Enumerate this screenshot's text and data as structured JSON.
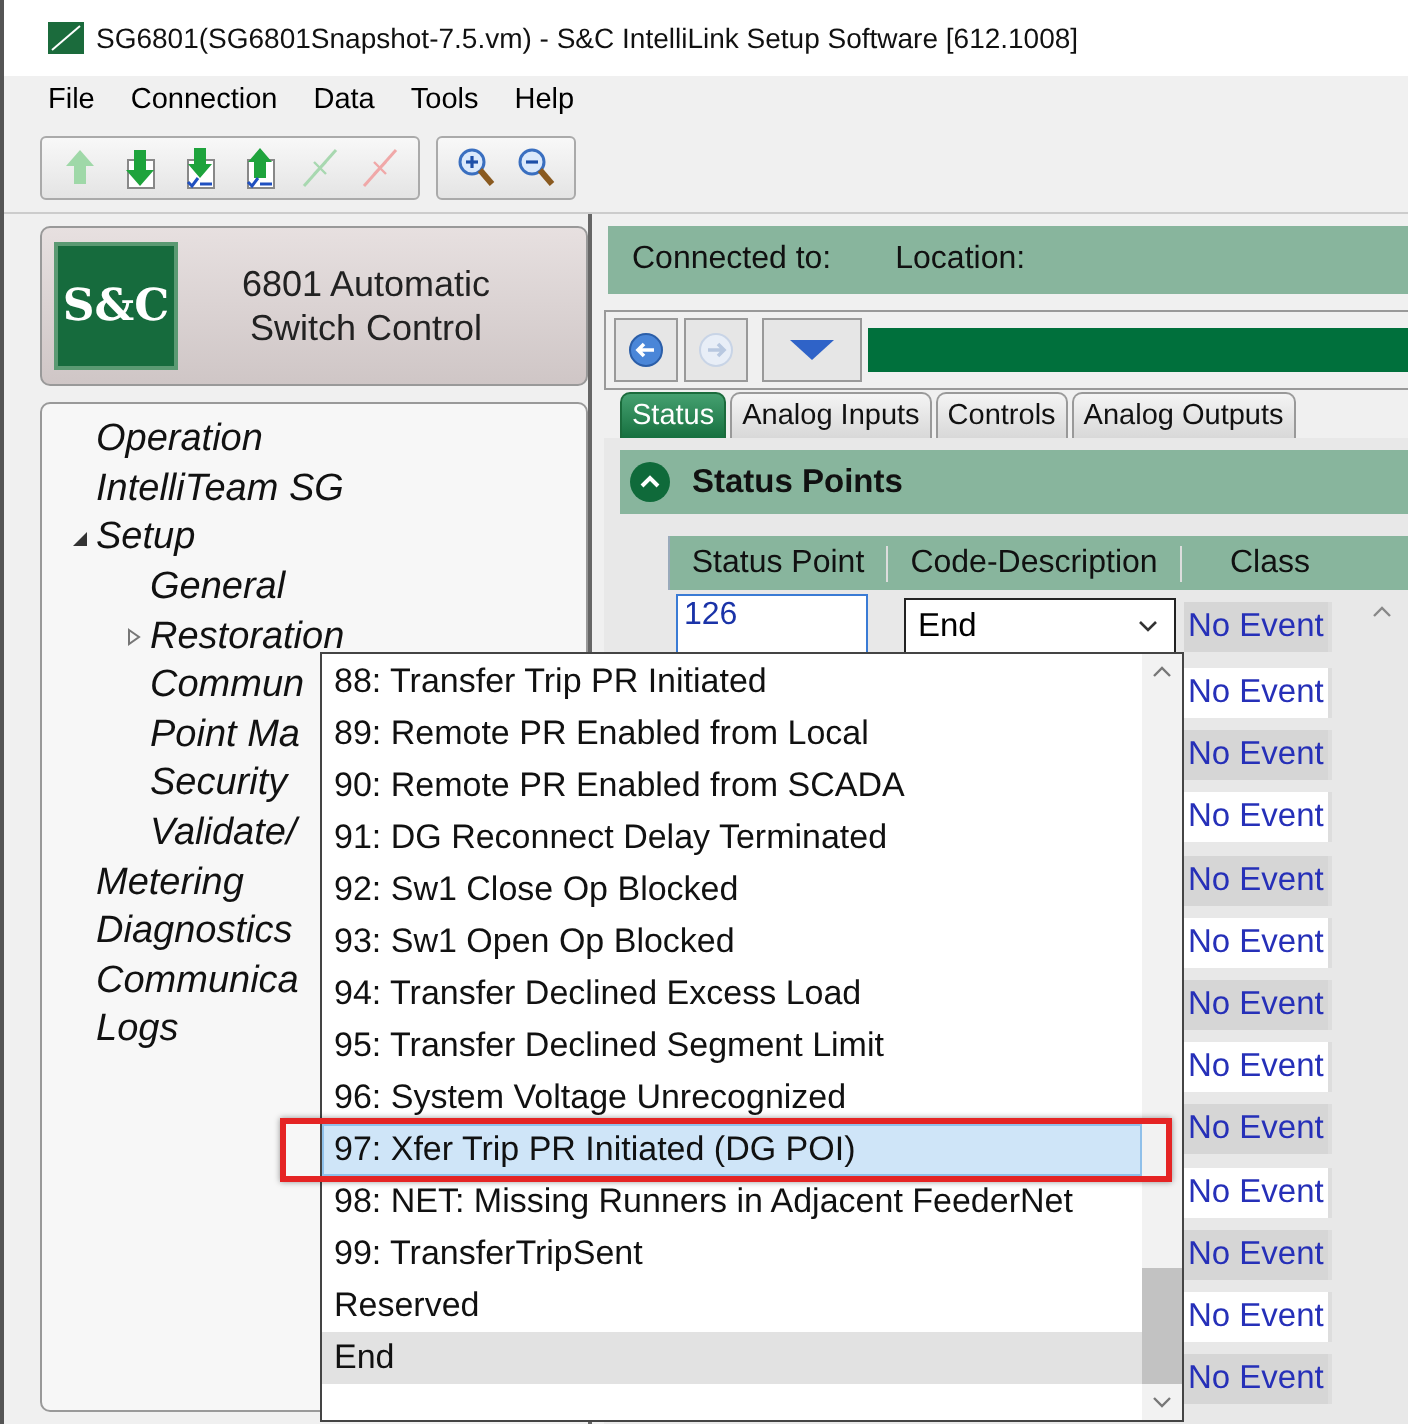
{
  "window": {
    "title": "SG6801(SG6801Snapshot-7.5.vm) - S&C IntelliLink Setup Software [612.1008]"
  },
  "menu": [
    "File",
    "Connection",
    "Data",
    "Tools",
    "Help"
  ],
  "toolbar": [
    [
      {
        "kind": "upload",
        "disabled": true
      },
      {
        "kind": "download",
        "disabled": false
      },
      {
        "kind": "download-check",
        "disabled": false
      },
      {
        "kind": "upload-check",
        "disabled": false
      },
      {
        "kind": "connect",
        "disabled": true
      },
      {
        "kind": "disconnect",
        "disabled": true
      }
    ],
    [
      {
        "kind": "zoom-in",
        "disabled": false
      },
      {
        "kind": "zoom-out",
        "disabled": false
      }
    ]
  ],
  "device": {
    "logo": "S&C",
    "name": "6801 Automatic Switch Control"
  },
  "nav": [
    {
      "label": "Operation"
    },
    {
      "label": "IntelliTeam SG"
    },
    {
      "label": "Setup",
      "expanded": true,
      "children": [
        {
          "label": "General"
        },
        {
          "label": "Restoration",
          "expanded": false
        },
        {
          "label": "Commun"
        },
        {
          "label": "Point Ma"
        },
        {
          "label": "Security"
        },
        {
          "label": "Validate/"
        }
      ]
    },
    {
      "label": "Metering"
    },
    {
      "label": "Diagnostics"
    },
    {
      "label": "Communica"
    },
    {
      "label": "Logs"
    }
  ],
  "connection": {
    "connected_to": "Connected to:",
    "location": "Location:"
  },
  "history": {
    "back_disabled": false,
    "forward_disabled": true
  },
  "tabs": [
    {
      "label": "Status",
      "selected": true
    },
    {
      "label": "Analog Inputs",
      "selected": false
    },
    {
      "label": "Controls",
      "selected": false
    },
    {
      "label": "Analog Outputs",
      "selected": false
    }
  ],
  "section": {
    "title": "Status Points",
    "expanded": true
  },
  "table": {
    "columns": [
      "Status Point",
      "Code-Description",
      "Class"
    ],
    "rows": [
      {
        "status_point": "126",
        "code_description": "End",
        "class": "No Event"
      },
      {
        "class": "No Event"
      },
      {
        "class": "No Event"
      },
      {
        "class": "No Event"
      },
      {
        "class": "No Event"
      },
      {
        "class": "No Event"
      },
      {
        "class": "No Event"
      },
      {
        "class": "No Event"
      },
      {
        "class": "No Event"
      },
      {
        "class": "No Event"
      },
      {
        "class": "No Event"
      },
      {
        "class": "No Event"
      },
      {
        "class": "No Event"
      }
    ]
  },
  "dropdown": {
    "items": [
      {
        "label": "88: Transfer Trip PR Initiated",
        "selected": false,
        "current": false
      },
      {
        "label": "89: Remote PR Enabled from Local",
        "selected": false,
        "current": false
      },
      {
        "label": "90: Remote PR Enabled from SCADA",
        "selected": false,
        "current": false
      },
      {
        "label": "91: DG Reconnect Delay Terminated",
        "selected": false,
        "current": false
      },
      {
        "label": "92: Sw1 Close Op Blocked",
        "selected": false,
        "current": false
      },
      {
        "label": "93: Sw1 Open Op Blocked",
        "selected": false,
        "current": false
      },
      {
        "label": "94: Transfer Declined Excess Load",
        "selected": false,
        "current": false
      },
      {
        "label": "95: Transfer Declined Segment Limit",
        "selected": false,
        "current": false
      },
      {
        "label": "96: System Voltage Unrecognized",
        "selected": false,
        "current": false
      },
      {
        "label": "97: Xfer Trip PR Initiated (DG POI)",
        "selected": true,
        "current": false
      },
      {
        "label": "98: NET: Missing Runners in Adjacent FeederNet",
        "selected": false,
        "current": false
      },
      {
        "label": "99: TransferTripSent",
        "selected": false,
        "current": false
      },
      {
        "label": "Reserved",
        "selected": false,
        "current": false
      },
      {
        "label": "End",
        "selected": false,
        "current": true
      }
    ]
  }
}
